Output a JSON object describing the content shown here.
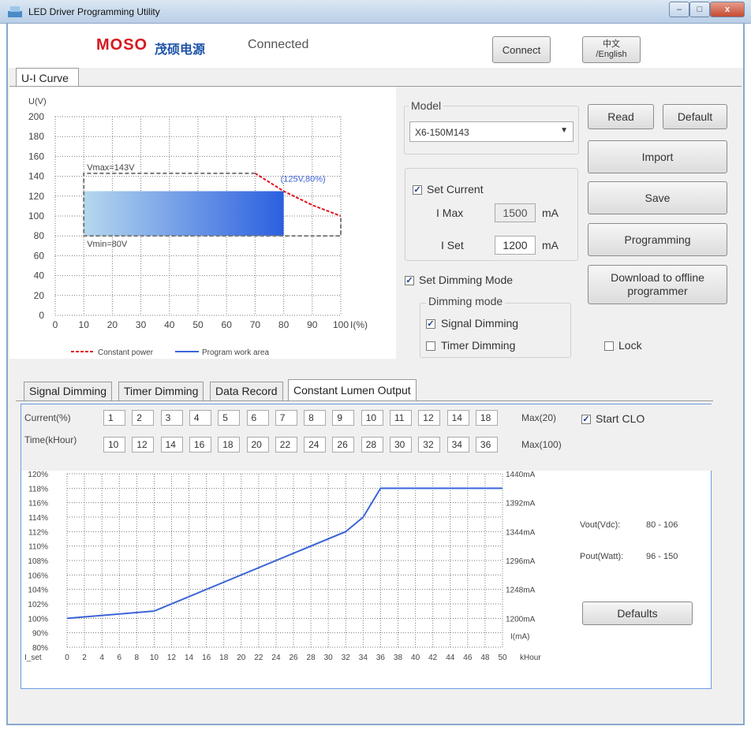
{
  "window": {
    "title": "LED Driver Programming Utility"
  },
  "header": {
    "brand": "MOSO",
    "brand_cn": "茂硕电源",
    "status": "Connected",
    "connect_label": "Connect",
    "lang_line1": "中文",
    "lang_line2": "/English"
  },
  "tabs_top": [
    {
      "label": "U-I Curve"
    }
  ],
  "ui_chart": {
    "type": "area",
    "ylabel": "U(V)",
    "xlabel": "I(%)",
    "y_ticks": [
      "200",
      "180",
      "160",
      "140",
      "120",
      "100",
      "80",
      "60",
      "40",
      "20",
      "0"
    ],
    "x_ticks": [
      "0",
      "10",
      "20",
      "30",
      "40",
      "50",
      "60",
      "70",
      "80",
      "90",
      "100"
    ],
    "ylim": [
      0,
      200
    ],
    "xlim": [
      0,
      100
    ],
    "vmax_label": "Vmax=143V",
    "vmin_label": "Vmin=80V",
    "point_label": "(125V,80%)",
    "legend_cp": "Constant power",
    "legend_pw": "Program work area",
    "vmax": 143,
    "vmin": 80,
    "imin": 10,
    "imax": 100,
    "work_current": 80,
    "work_voltage": 125,
    "constant_power_curve": [
      [
        70,
        143
      ],
      [
        80,
        125
      ],
      [
        90,
        111
      ],
      [
        100,
        100
      ]
    ]
  },
  "model": {
    "legend": "Model",
    "selected": "X6-150M143"
  },
  "buttons": {
    "read": "Read",
    "default": "Default",
    "import": "Import",
    "save": "Save",
    "programming": "Programming",
    "download_line1": "Download to offline",
    "download_line2": "programmer",
    "defaults": "Defaults"
  },
  "current": {
    "set_current_label": "Set Current",
    "imax_label": "I Max",
    "imax_value": "1500",
    "iset_label": "I Set",
    "iset_value": "1200",
    "unit": "mA"
  },
  "dimming": {
    "set_dimming_label": "Set Dimming Mode",
    "group_label": "Dimming mode",
    "signal_label": "Signal Dimming",
    "timer_label": "Timer Dimming",
    "lock_label": "Lock"
  },
  "tabs_bottom": [
    {
      "label": "Signal Dimming"
    },
    {
      "label": "Timer Dimming"
    },
    {
      "label": "Data Record"
    },
    {
      "label": "Constant Lumen Output"
    }
  ],
  "clo": {
    "current_label": "Current(%)",
    "time_label": "Time(kHour)",
    "current_values": [
      "1",
      "2",
      "3",
      "4",
      "5",
      "6",
      "7",
      "8",
      "9",
      "10",
      "11",
      "12",
      "14",
      "18"
    ],
    "time_values": [
      "10",
      "12",
      "14",
      "16",
      "18",
      "20",
      "22",
      "24",
      "26",
      "28",
      "30",
      "32",
      "34",
      "36"
    ],
    "current_max": "Max(20)",
    "time_max": "Max(100)",
    "start_label": "Start CLO",
    "vout_label": "Vout(Vdc):",
    "vout_value": "80 - 106",
    "pout_label": "Pout(Watt):",
    "pout_value": "96 - 150"
  },
  "chart_data": {
    "type": "line",
    "y_ticks": [
      "120%",
      "118%",
      "116%",
      "114%",
      "112%",
      "110%",
      "108%",
      "106%",
      "104%",
      "102%",
      "100%",
      "90%",
      "80%"
    ],
    "x_ticks": [
      "0",
      "2",
      "4",
      "6",
      "8",
      "10",
      "12",
      "14",
      "16",
      "18",
      "20",
      "22",
      "24",
      "26",
      "28",
      "30",
      "32",
      "34",
      "36",
      "38",
      "40",
      "42",
      "44",
      "46",
      "48",
      "50"
    ],
    "x_label_left": "I_set",
    "x_unit": "kHour",
    "right_ticks": [
      "1440mA",
      "1392mA",
      "1344mA",
      "1296mA",
      "1248mA",
      "1200mA"
    ],
    "right_unit": "I(mA)",
    "x": [
      0,
      10,
      32,
      34,
      36,
      50
    ],
    "y": [
      100,
      101,
      112,
      114,
      118,
      118
    ]
  }
}
